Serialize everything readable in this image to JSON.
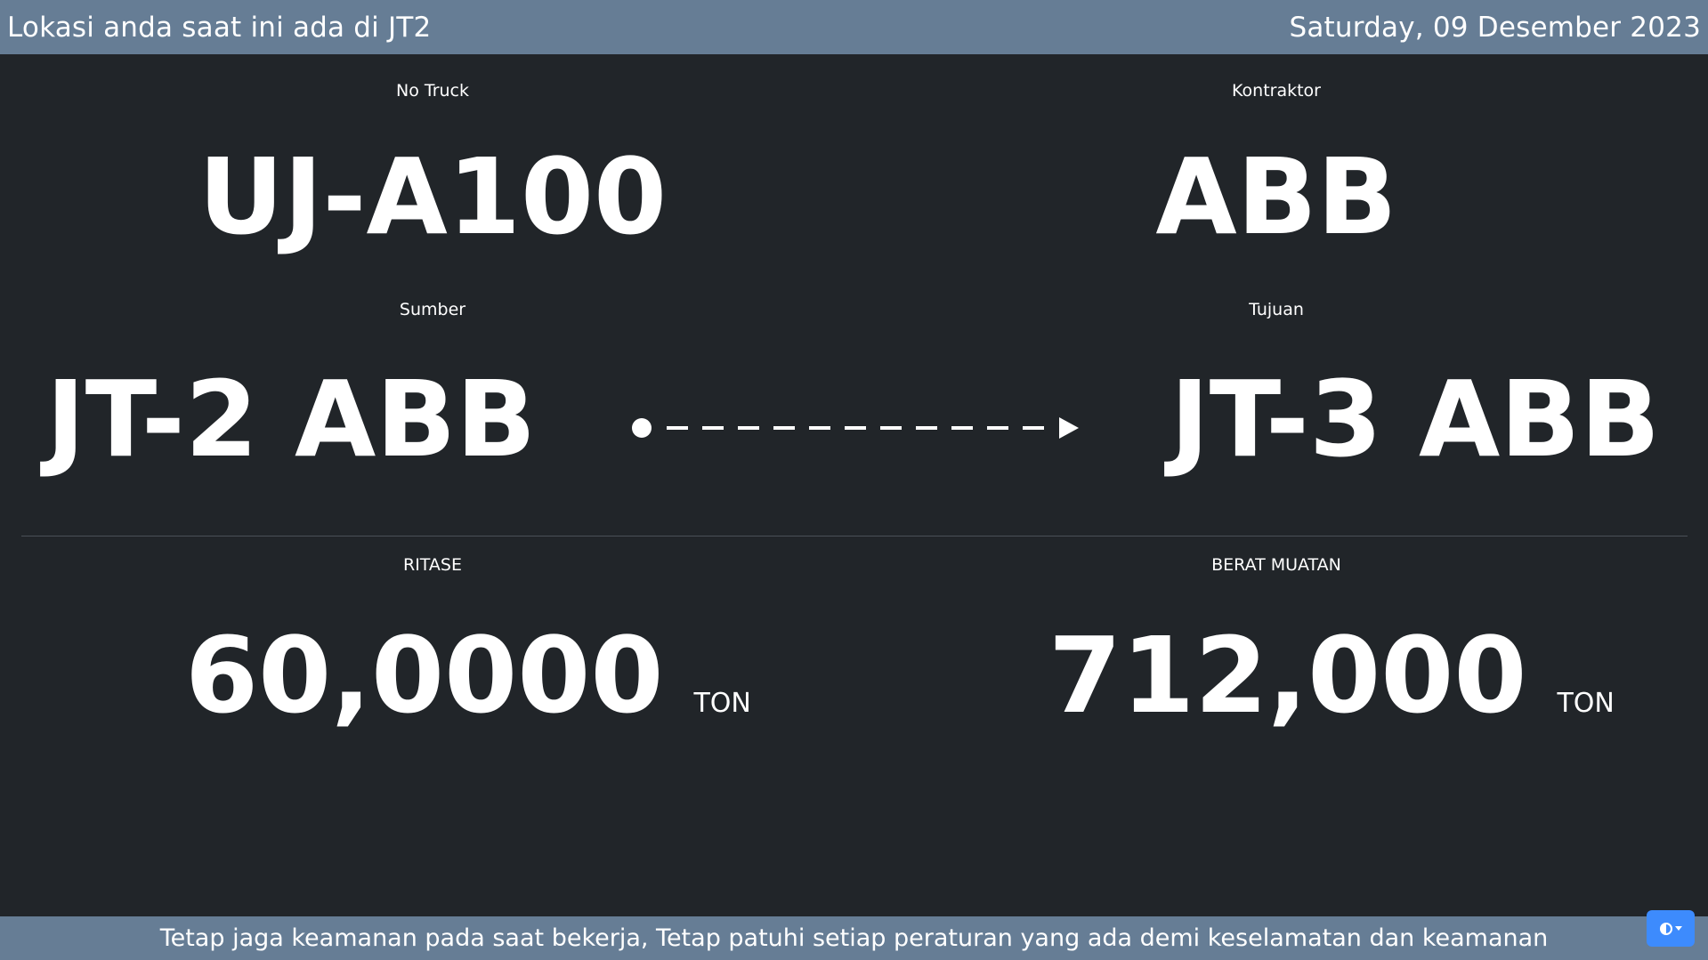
{
  "header": {
    "location_text": "Lokasi anda saat ini ada di JT2",
    "date_text": "Saturday, 09 Desember 2023"
  },
  "truck": {
    "label": "No Truck",
    "value": "UJ-A100"
  },
  "contractor": {
    "label": "Kontraktor",
    "value": "ABB"
  },
  "source": {
    "label": "Sumber",
    "value": "JT-2 ABB"
  },
  "destination": {
    "label": "Tujuan",
    "value": "JT-3 ABB"
  },
  "ritase": {
    "label": "RITASE",
    "value": "60,0000",
    "unit": "TON"
  },
  "berat_muatan": {
    "label": "BERAT MUATAN",
    "value": "712,000",
    "unit": "TON"
  },
  "footer": {
    "message": "Tetap jaga keamanan pada saat bekerja, Tetap patuhi setiap peraturan yang ada demi keselamatan dan keamanan"
  },
  "colors": {
    "background": "#212529",
    "bar": "#667d95",
    "accent_button": "#3d8bfd"
  },
  "icons": {
    "route": "dashed-arrow-icon",
    "theme": "contrast-icon"
  }
}
